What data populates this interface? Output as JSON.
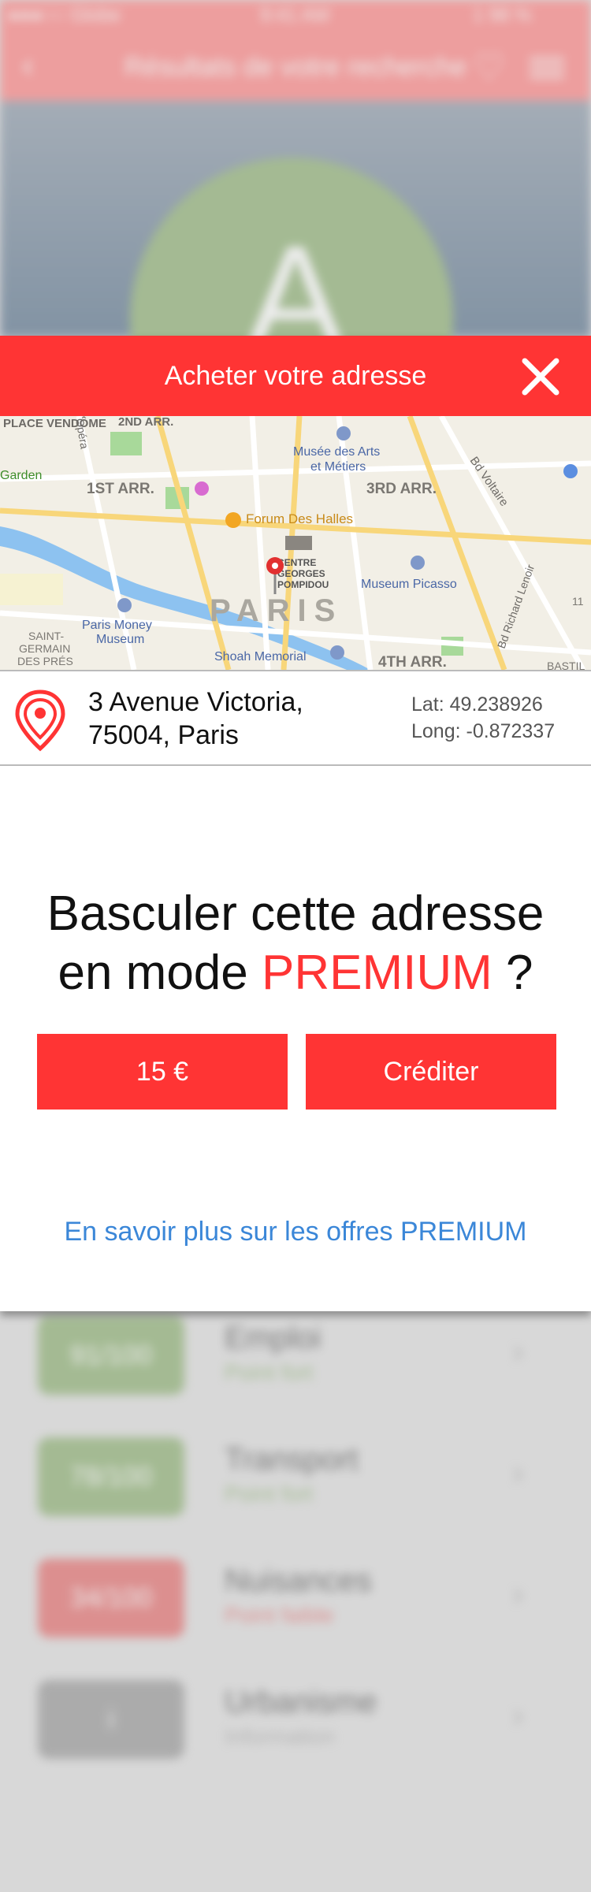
{
  "background": {
    "status": {
      "carrier": "●●●○○ Globe",
      "time": "9:41 AM",
      "battery": "1 98 %"
    },
    "nav": {
      "title": "Résultats de votre recherche"
    },
    "hero": {
      "letter": "A"
    },
    "rows": [
      {
        "score": "91/100",
        "name": "Emploi",
        "sub": "Point fort",
        "color": "#7aa35b"
      },
      {
        "score": "78/100",
        "name": "Transport",
        "sub": "Point fort",
        "color": "#7aa35b"
      },
      {
        "score": "34/100",
        "name": "Nuisances",
        "sub": "Point faible",
        "color": "#e05555"
      },
      {
        "score": "i",
        "name": "Urbanisme",
        "sub": "Information",
        "color": "#888888"
      }
    ]
  },
  "modal": {
    "title": "Acheter votre adresse",
    "map": {
      "labels": {
        "place_vendome": "PLACE VENDÔME",
        "opera": "Opéra",
        "arr2": "2ND ARR.",
        "musee": "Musée des Arts",
        "musee2": "et Métiers",
        "bd_voltaire": "Bd Voltaire",
        "garden": "Garden",
        "arr1": "1ST ARR.",
        "arr3": "3RD ARR.",
        "forum": "Forum Des Halles",
        "centre": "CENTRE",
        "georges": "GEORGES",
        "pompidou": "POMPIDOU",
        "picasso": "Museum Picasso",
        "richard_lenoir": "Bd Richard Lenoir",
        "paris": "PARIS",
        "money1": "Paris Money",
        "money2": "Museum",
        "saint": "SAINT-",
        "germain": "GERMAIN",
        "pres": "DES PRÉS",
        "shoah": "Shoah Memorial",
        "arr4": "4TH ARR.",
        "bastille": "BASTIL",
        "arr11": "11"
      }
    },
    "address": {
      "line1": "3 Avenue Victoria,",
      "line2": "75004, Paris",
      "lat": "Lat: 49.238926",
      "long": "Long: -0.872337"
    },
    "question_part1": "Basculer cette adresse",
    "question_part2": "en mode ",
    "question_premium": "PREMIUM",
    "question_part3": " ?",
    "price_button": "15 €",
    "credit_button": "Créditer",
    "more_link": "En savoir plus sur les offres PREMIUM"
  },
  "colors": {
    "accent": "#ff3434",
    "link": "#3b87d8"
  },
  "icons": {
    "close": "close-icon",
    "pin": "location-pin-icon"
  }
}
